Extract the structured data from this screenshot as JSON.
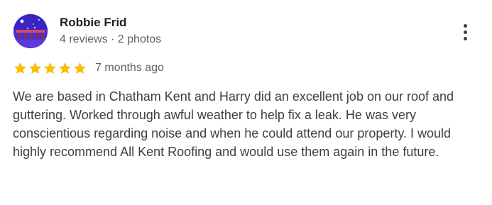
{
  "reviewer": {
    "name": "Robbie Frid",
    "meta": "4 reviews · 2 photos"
  },
  "rating": {
    "stars": 5,
    "max": 5,
    "color": "#fbbc04"
  },
  "review": {
    "date": "7 months ago",
    "text": "We are based in Chatham Kent and Harry did an excellent job on our roof and guttering. Worked through awful weather to help fix a leak. He was very conscientious regarding noise and when he could attend our property. I would highly recommend All Kent Roofing and would use them again in the future."
  },
  "icons": {
    "more": "more-vert-icon",
    "star": "star-icon"
  }
}
